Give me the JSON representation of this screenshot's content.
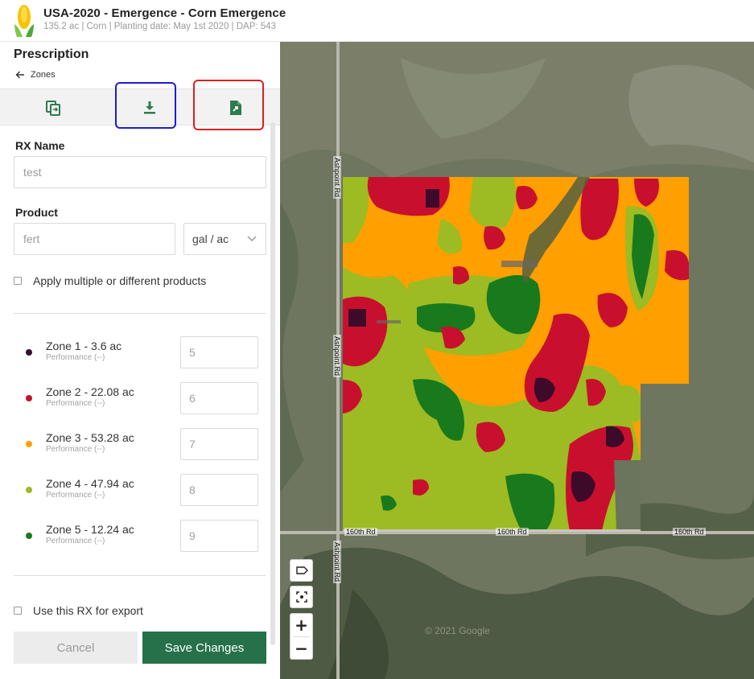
{
  "header": {
    "title": "USA-2020 - Emergence - Corn Emergence",
    "subtitle": "135.2 ac | Corn | Planting date: May 1st 2020 | DAP: 543",
    "logo_icon": "corn-icon"
  },
  "panel": {
    "title": "Prescription",
    "back_label": "Zones",
    "toolbar": [
      {
        "name": "copy-button",
        "icon": "copy-icon"
      },
      {
        "name": "download-button",
        "icon": "download-icon"
      },
      {
        "name": "export-file-button",
        "icon": "file-export-icon"
      }
    ],
    "rx_name_label": "RX Name",
    "rx_name_value": "test",
    "product_label": "Product",
    "product_value": "fert",
    "unit_value": "gal / ac",
    "multiple_products_label": "Apply multiple or different products",
    "zones": [
      {
        "name": "Zone 1 - 3.6 ac",
        "performance": "Performance (--)",
        "value": "5",
        "color": "#3d0a2a"
      },
      {
        "name": "Zone 2 - 22.08 ac",
        "performance": "Performance (--)",
        "value": "6",
        "color": "#c8102e"
      },
      {
        "name": "Zone 3 - 53.28 ac",
        "performance": "Performance (--)",
        "value": "7",
        "color": "#ff9f00"
      },
      {
        "name": "Zone 4 - 47.94 ac",
        "performance": "Performance (--)",
        "value": "8",
        "color": "#9dbb22"
      },
      {
        "name": "Zone 5 - 12.24 ac",
        "performance": "Performance (--)",
        "value": "9",
        "color": "#187a1c"
      }
    ],
    "export_label": "Use this RX for export",
    "cancel_label": "Cancel",
    "save_label": "Save Changes"
  },
  "map": {
    "road_labels": [
      "Ashpoint Rd",
      "Ashpoint Rd",
      "Ashpoint Rd",
      "160th Rd",
      "160th Rd",
      "160th Rd"
    ],
    "watermark": "© 2021 Google",
    "controls": {
      "zoom_in": "+",
      "zoom_out": "−"
    }
  },
  "colors": {
    "accent": "#27714a",
    "zone1": "#3d0a2a",
    "zone2": "#c8102e",
    "zone3": "#ff9f00",
    "zone4": "#9dbb22",
    "zone5": "#187a1c",
    "annotation_blue": "#1b1bd6",
    "annotation_red": "#e01e1e"
  }
}
